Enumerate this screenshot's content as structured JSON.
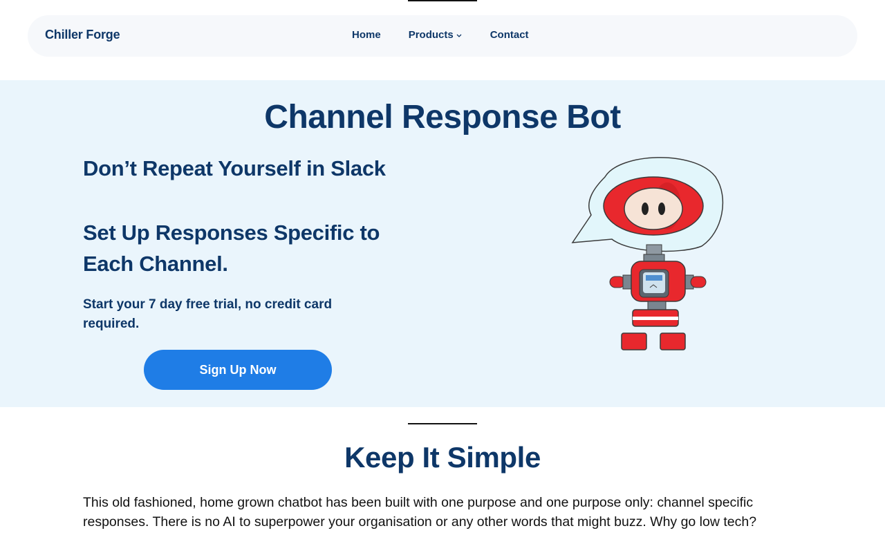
{
  "brand": "Chiller Forge",
  "nav": {
    "items": [
      {
        "label": "Home"
      },
      {
        "label": "Products"
      },
      {
        "label": "Contact"
      }
    ]
  },
  "hero": {
    "title": "Channel Response Bot",
    "subtitle1": "Don’t Repeat Yourself in Slack",
    "subtitle2": "Set Up Responses Specific to Each Channel.",
    "trial": "Start your 7 day free trial, no credit card required.",
    "cta": "Sign Up Now",
    "robot_icon": "robot-mascot-icon"
  },
  "section": {
    "title": "Keep It Simple",
    "body": "This old fashioned, home grown chatbot has been built with one purpose and one purpose only: channel specific responses. There is no AI to superpower your organisation or any other words that might buzz. Why go low tech?"
  },
  "colors": {
    "navy": "#0e3768",
    "accent": "#1f7de6",
    "hero_bg": "#eaf5fc",
    "robot_red": "#e8282d"
  }
}
